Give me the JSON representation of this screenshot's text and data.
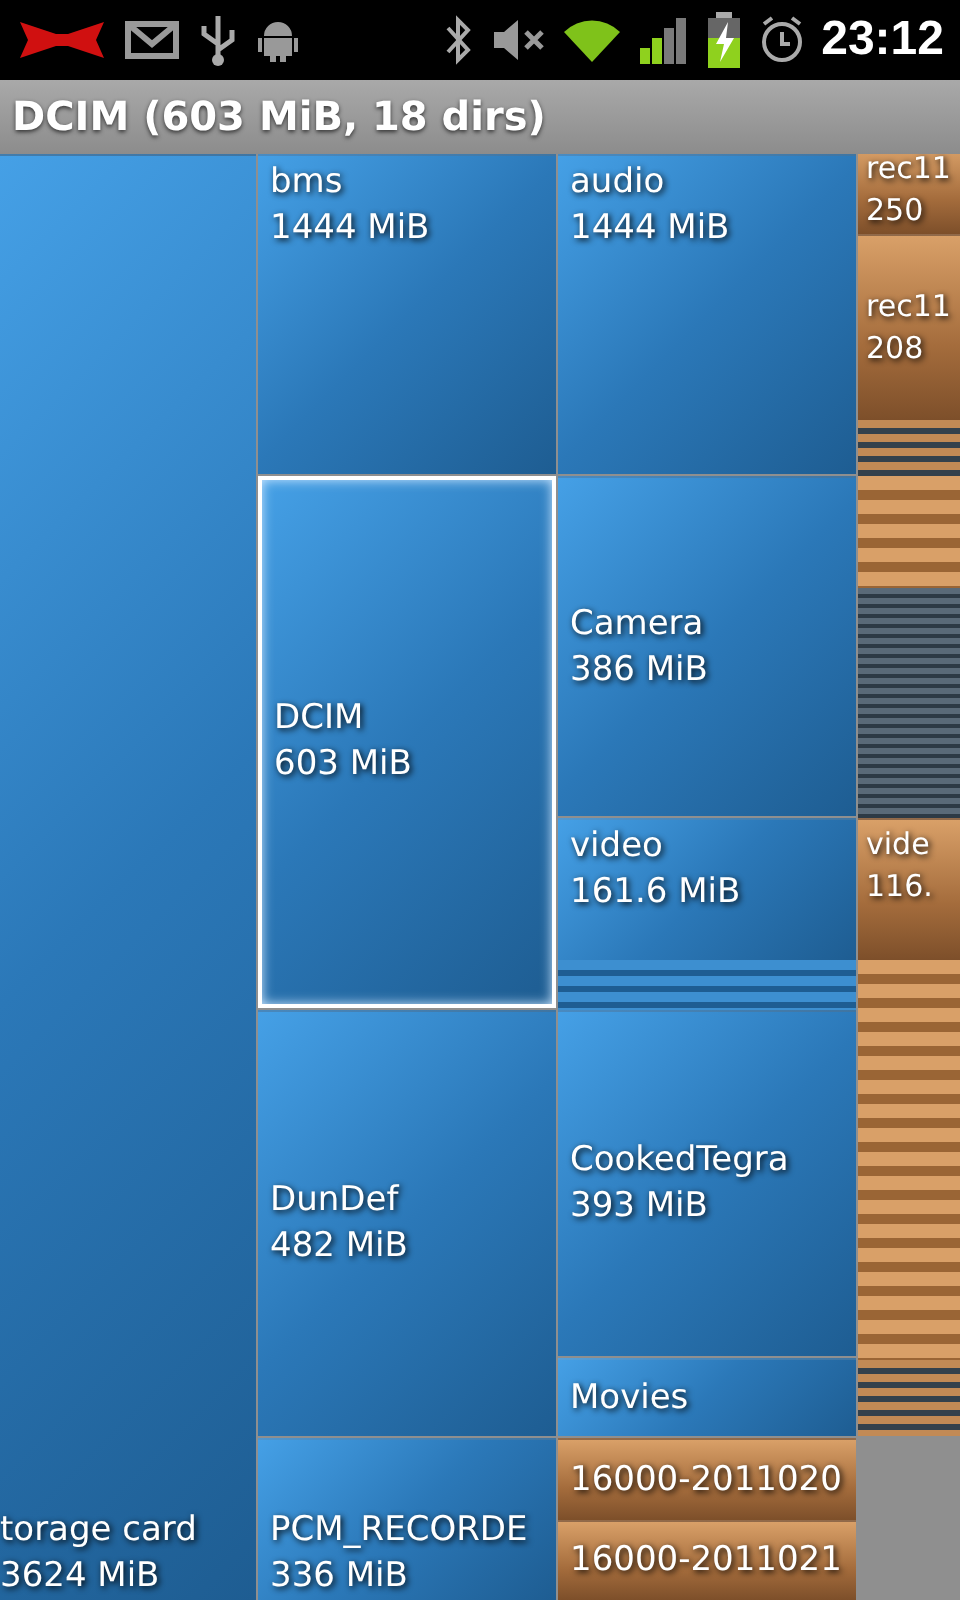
{
  "status_bar": {
    "time": "23:12"
  },
  "title": "DCIM (603 MiB, 18 dirs)",
  "tiles": [
    {
      "name": "torage card",
      "size": "3624 MiB",
      "kind": "dir",
      "selected": false
    },
    {
      "name": "bms",
      "size": "1444 MiB",
      "kind": "dir",
      "selected": false
    },
    {
      "name": "DCIM",
      "size": "603 MiB",
      "kind": "dir",
      "selected": true
    },
    {
      "name": "DunDef",
      "size": "482 MiB",
      "kind": "dir",
      "selected": false
    },
    {
      "name": "PCM_RECORDE",
      "size": "336 MiB",
      "kind": "dir",
      "selected": false
    },
    {
      "name": "audio",
      "size": "1444 MiB",
      "kind": "dir",
      "selected": false
    },
    {
      "name": "Camera",
      "size": "386 MiB",
      "kind": "dir",
      "selected": false
    },
    {
      "name": "video",
      "size": "161.6 MiB",
      "kind": "dir",
      "selected": false
    },
    {
      "name": "CookedTegra",
      "size": "393 MiB",
      "kind": "dir",
      "selected": false
    },
    {
      "name": "Movies",
      "kind": "dir",
      "selected": false
    },
    {
      "name": "16000-2011020",
      "kind": "file",
      "selected": false
    },
    {
      "name": "16000-2011021",
      "kind": "file",
      "selected": false
    },
    {
      "name": "rec11",
      "size": "250",
      "kind": "file",
      "selected": false
    },
    {
      "name": "rec11",
      "size": "208",
      "kind": "file",
      "selected": false
    },
    {
      "name": "vide",
      "size": "116.",
      "kind": "file",
      "selected": false
    }
  ]
}
